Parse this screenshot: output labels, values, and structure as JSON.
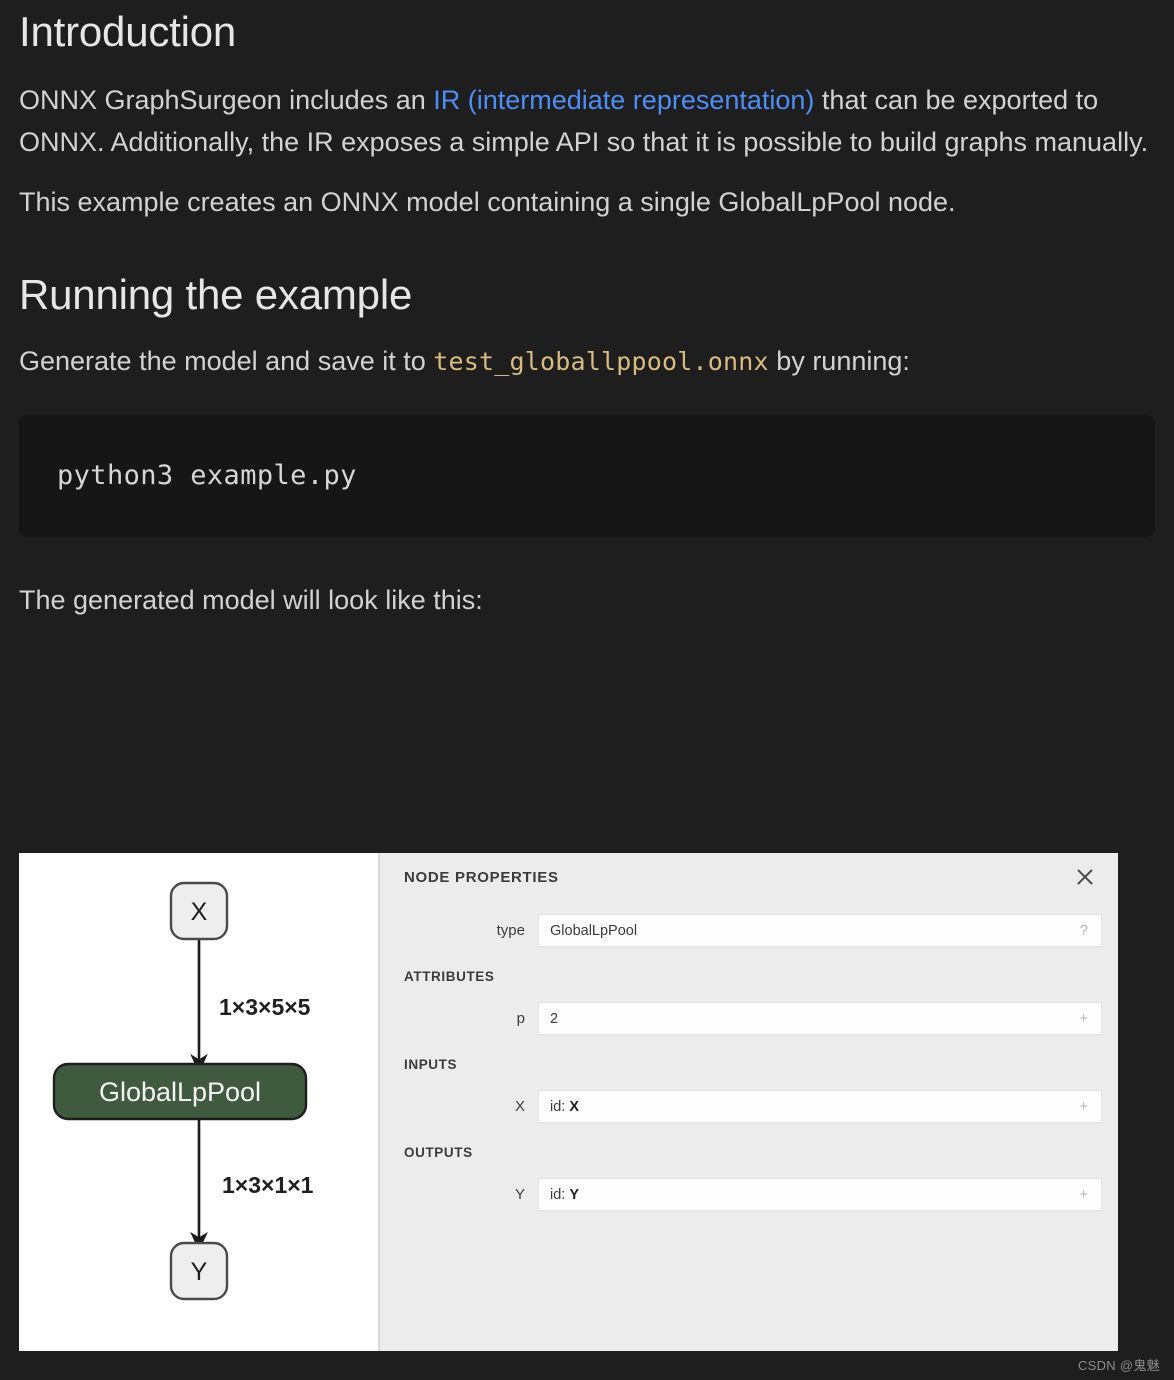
{
  "document": {
    "sections": [
      {
        "heading": "Introduction",
        "paragraphs": [
          {
            "before": "ONNX GraphSurgeon includes an ",
            "link": "IR (intermediate representation)",
            "after": " that can be exported to ONNX. Additionally, the IR exposes a simple API so that it is possible to build graphs manually."
          },
          {
            "text": "This example creates an ONNX model containing a single GlobalLpPool node."
          }
        ]
      },
      {
        "heading": "Running the example",
        "intro_before": "Generate the model and save it to ",
        "intro_code": "test_globallppool.onnx",
        "intro_after": " by running:",
        "code_block": "python3 example.py",
        "outro": "The generated model will look like this:"
      }
    ]
  },
  "colors": {
    "page_background": "#1e1e1e",
    "link": "#4d8df8",
    "inline_code": "#d9bb7e",
    "code_block_background": "#161616",
    "graph_node_op": "#3f5a3f",
    "panel_background": "#ececec"
  },
  "graph": {
    "input_node": "X",
    "op_node": "GlobalLpPool",
    "output_node": "Y",
    "edge_in_label": "1×3×5×5",
    "edge_out_label": "1×3×1×1"
  },
  "properties_panel": {
    "title": "NODE PROPERTIES",
    "close_label": "×",
    "type_field": {
      "name": "type",
      "value": "GlobalLpPool",
      "affordance": "?"
    },
    "attributes_label": "ATTRIBUTES",
    "attributes": [
      {
        "name": "p",
        "value": "2",
        "affordance": "+"
      }
    ],
    "inputs_label": "INPUTS",
    "inputs": [
      {
        "name": "X",
        "prefix": "id: ",
        "value": "X",
        "affordance": "+"
      }
    ],
    "outputs_label": "OUTPUTS",
    "outputs": [
      {
        "name": "Y",
        "prefix": "id: ",
        "value": "Y",
        "affordance": "+"
      }
    ]
  },
  "watermark": "CSDN @鬼魅"
}
